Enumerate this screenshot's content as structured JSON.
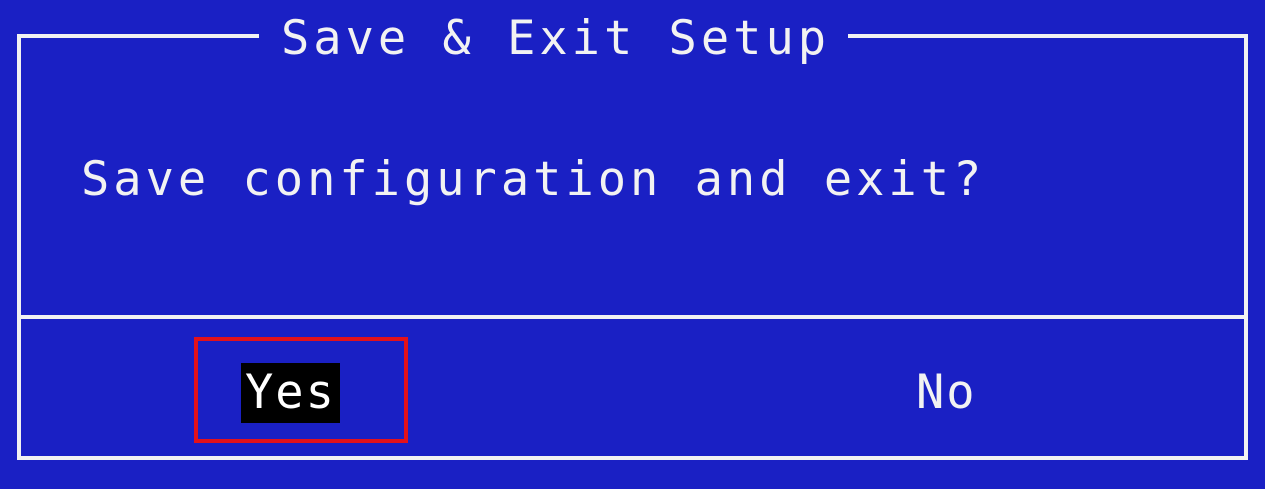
{
  "dialog": {
    "title": "Save & Exit Setup",
    "message": "Save configuration and exit?",
    "options": [
      {
        "label": "Yes",
        "selected": true
      },
      {
        "label": "No",
        "selected": false
      }
    ]
  },
  "colors": {
    "background": "#1a20c4",
    "text": "#f2f2f2",
    "selected_background": "#000000",
    "focus_outline": "#e3111a"
  }
}
